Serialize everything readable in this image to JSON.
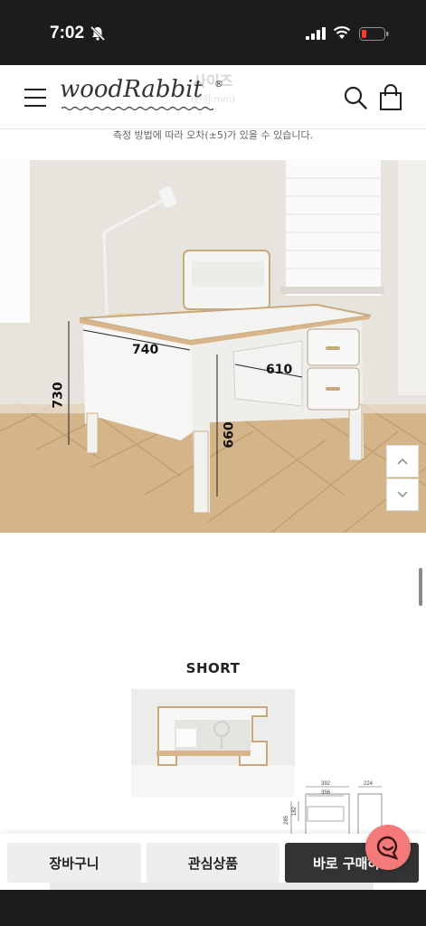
{
  "status_bar": {
    "time": "7:02",
    "icons": [
      "bell-slash-icon",
      "signal-icon",
      "wifi-icon",
      "battery-low-icon"
    ],
    "battery_color": "#ff3b30"
  },
  "header": {
    "brand": "woodRabbit",
    "brand_mark": "®",
    "ghost_title": "사이즈",
    "ghost_subtitle": "(단위:mm)",
    "icons": [
      "menu-icon",
      "search-icon",
      "shopping-bag-icon"
    ]
  },
  "note": "측정 방법에 따라 오차(±5)가 있을 수 있습니다.",
  "desk_dimensions": {
    "width": "740",
    "height": "730",
    "depth": "610",
    "leg_clearance": "660"
  },
  "scroll_controls": {
    "up_icon": "chevron-up-icon",
    "down_icon": "chevron-down-icon"
  },
  "short_section": {
    "label": "SHORT",
    "dims": {
      "top_total": "392",
      "top_inner": "356",
      "side": "224",
      "height": "285",
      "inner_height": "182"
    }
  },
  "actions": {
    "cart": "장바구니",
    "wishlist": "관심상품",
    "buy_now": "바로 구매하기"
  },
  "colors": {
    "status_bar": "#1c1c1e",
    "buy_button": "#333333",
    "chat_button": "#f47a7a"
  }
}
